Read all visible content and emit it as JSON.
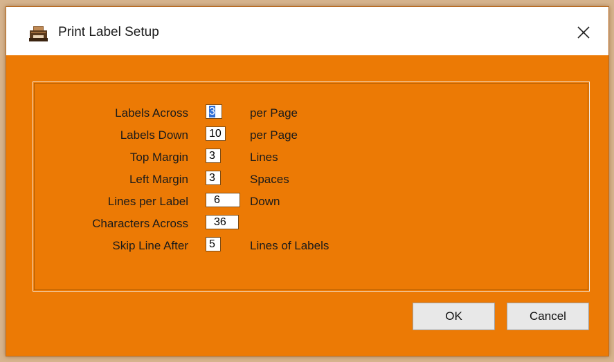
{
  "window": {
    "title": "Print Label Setup",
    "icon": "printer-app-icon",
    "close_icon": "close-icon",
    "accent_color": "#ec7a05"
  },
  "fields": [
    {
      "label": "Labels Across",
      "value": "3",
      "unit": "per Page",
      "focused": true
    },
    {
      "label": "Labels Down",
      "value": "10",
      "unit": "per Page"
    },
    {
      "label": "Top Margin",
      "value": "3",
      "unit": "Lines"
    },
    {
      "label": "Left Margin",
      "value": "3",
      "unit": "Spaces"
    },
    {
      "label": "Lines per Label",
      "value": "6",
      "unit": "Down"
    },
    {
      "label": "Characters Across",
      "value": "36",
      "unit": ""
    },
    {
      "label": "Skip Line After",
      "value": "5",
      "unit": "Lines of Labels"
    }
  ],
  "buttons": {
    "ok": "OK",
    "cancel": "Cancel"
  }
}
